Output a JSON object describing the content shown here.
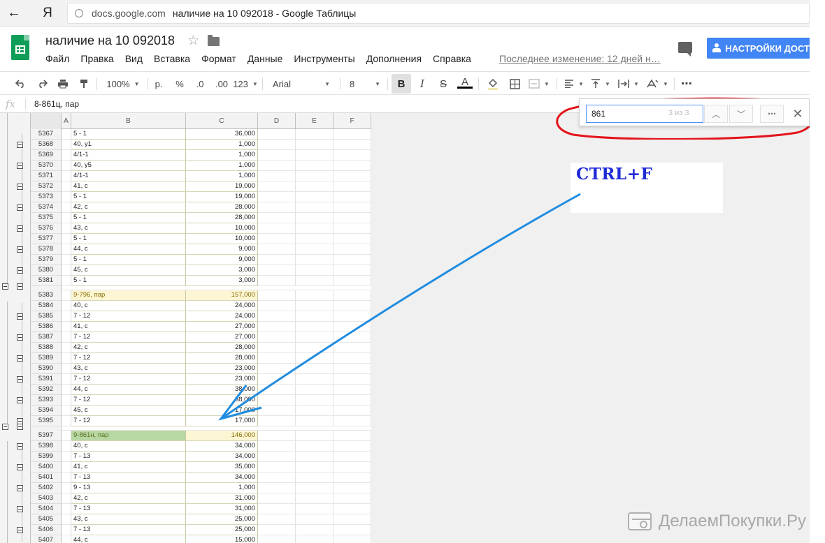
{
  "browser": {
    "back_glyph": "←",
    "yandex_label": "Я",
    "domain": "docs.google.com",
    "tab_title": "наличие на 10 092018 - Google Таблицы"
  },
  "header": {
    "doc_title": "наличие на 10 092018",
    "menu": [
      "Файл",
      "Правка",
      "Вид",
      "Вставка",
      "Формат",
      "Данные",
      "Инструменты",
      "Дополнения",
      "Справка"
    ],
    "last_edit": "Последнее изменение: 12 дней н…",
    "share_label": "НАСТРОЙКИ ДОСТ",
    "accent_color": "#4285f4",
    "logo_color": "#0f9d58"
  },
  "toolbar": {
    "zoom": "100%",
    "currency": "р.",
    "percent": "%",
    "dec_less": ".0",
    "dec_more": ".00",
    "format_more": "123",
    "font": "Arial",
    "font_size": "8",
    "bold": "B",
    "italic": "I",
    "strike": "S",
    "text_color": "A",
    "more": "⋯"
  },
  "formula_bar": {
    "fx_label": "fx",
    "content": "8-861ц, пар"
  },
  "grid": {
    "columns": [
      "A",
      "B",
      "C",
      "D",
      "E",
      "F"
    ],
    "rows": [
      {
        "n": "5367",
        "b": "5 - 1",
        "c": "36,000"
      },
      {
        "n": "5368",
        "b": "40, у1",
        "c": "1,000"
      },
      {
        "n": "5369",
        "b": "4/1-1",
        "c": "1,000"
      },
      {
        "n": "5370",
        "b": "40, у5",
        "c": "1,000"
      },
      {
        "n": "5371",
        "b": "4/1-1",
        "c": "1,000"
      },
      {
        "n": "5372",
        "b": "41, с",
        "c": "19,000"
      },
      {
        "n": "5373",
        "b": "5 - 1",
        "c": "19,000"
      },
      {
        "n": "5374",
        "b": "42, с",
        "c": "28,000"
      },
      {
        "n": "5375",
        "b": "5 - 1",
        "c": "28,000"
      },
      {
        "n": "5376",
        "b": "43, с",
        "c": "10,000"
      },
      {
        "n": "5377",
        "b": "5 - 1",
        "c": "10,000"
      },
      {
        "n": "5378",
        "b": "44, с",
        "c": "9,000"
      },
      {
        "n": "5379",
        "b": "5 - 1",
        "c": "9,000"
      },
      {
        "n": "5380",
        "b": "45, с",
        "c": "3,000"
      },
      {
        "n": "5381",
        "b": "5 - 1",
        "c": "3,000"
      },
      {
        "n": "5383",
        "b": "9-796, пар",
        "c": "157,000",
        "kind": "group"
      },
      {
        "n": "5384",
        "b": "40, с",
        "c": "24,000"
      },
      {
        "n": "5385",
        "b": "7 - 12",
        "c": "24,000"
      },
      {
        "n": "5386",
        "b": "41, с",
        "c": "27,000"
      },
      {
        "n": "5387",
        "b": "7 - 12",
        "c": "27,000"
      },
      {
        "n": "5388",
        "b": "42, с",
        "c": "28,000"
      },
      {
        "n": "5389",
        "b": "7 - 12",
        "c": "28,000"
      },
      {
        "n": "5390",
        "b": "43, с",
        "c": "23,000"
      },
      {
        "n": "5391",
        "b": "7 - 12",
        "c": "23,000"
      },
      {
        "n": "5392",
        "b": "44, с",
        "c": "38,000"
      },
      {
        "n": "5393",
        "b": "7 - 12",
        "c": "38,000"
      },
      {
        "n": "5394",
        "b": "45, с",
        "c": "17,000"
      },
      {
        "n": "5395",
        "b": "7 - 12",
        "c": "17,000"
      },
      {
        "n": "5397",
        "b": "9-861н, пар",
        "c": "146,000",
        "kind": "match"
      },
      {
        "n": "5398",
        "b": "40, с",
        "c": "34,000"
      },
      {
        "n": "5399",
        "b": "7 - 13",
        "c": "34,000"
      },
      {
        "n": "5400",
        "b": "41, с",
        "c": "35,000"
      },
      {
        "n": "5401",
        "b": "7 - 13",
        "c": "34,000"
      },
      {
        "n": "5402",
        "b": "9 - 13",
        "c": "1,000"
      },
      {
        "n": "5403",
        "b": "42, с",
        "c": "31,000"
      },
      {
        "n": "5404",
        "b": "7 - 13",
        "c": "31,000"
      },
      {
        "n": "5405",
        "b": "43, с",
        "c": "25,000"
      },
      {
        "n": "5406",
        "b": "7 - 13",
        "c": "25,000"
      },
      {
        "n": "5407",
        "b": "44, с",
        "c": "15,000"
      }
    ]
  },
  "find": {
    "query": "861",
    "count": "3 из 3",
    "prev_glyph": "︿",
    "next_glyph": "﹀",
    "more_glyph": "⋯",
    "close_glyph": "✕"
  },
  "annotation": {
    "note": "CTRL+F",
    "ellipse_color": "#e3141b",
    "arrow_color": "#1f8ce0",
    "note_color": "#1e2bd6"
  },
  "watermark": {
    "text": "ДелаемПокупки.Ру"
  }
}
